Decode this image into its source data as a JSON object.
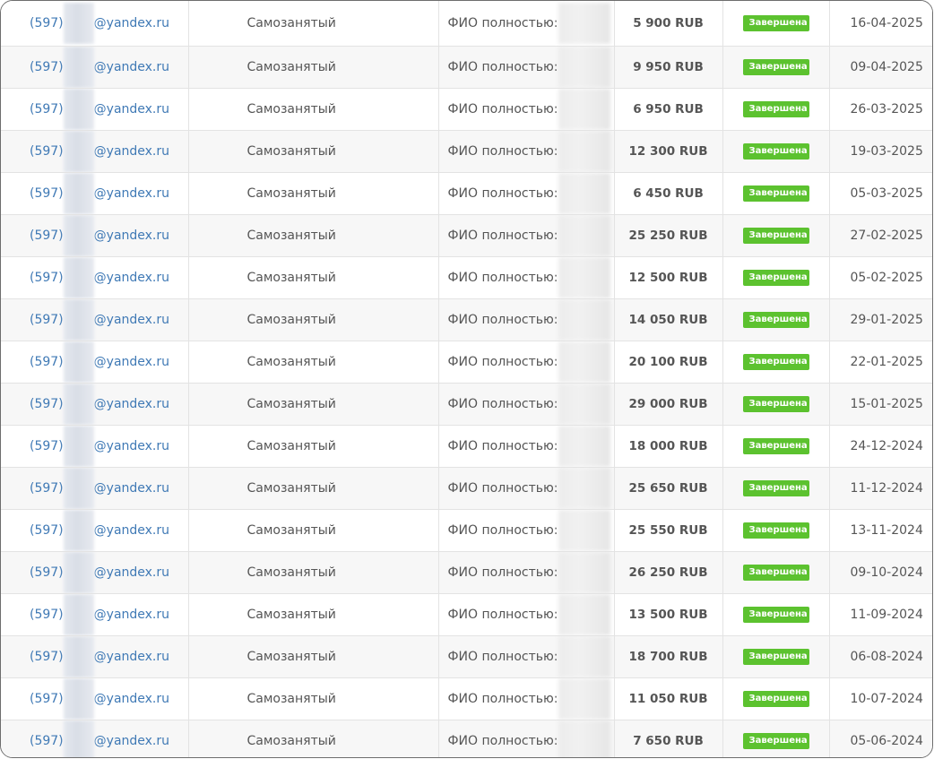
{
  "status_color": "#5cc22f",
  "link_color": "#3f79b5",
  "rows": [
    {
      "email_prefix": "(597)",
      "email_domain": "@yandex.ru",
      "type": "Самозанятый",
      "fio_label": "ФИО полностью:",
      "amount": "5 900 RUB",
      "status": "Завершена",
      "date": "16-04-2025"
    },
    {
      "email_prefix": "(597)",
      "email_domain": "@yandex.ru",
      "type": "Самозанятый",
      "fio_label": "ФИО полностью:",
      "amount": "9 950 RUB",
      "status": "Завершена",
      "date": "09-04-2025"
    },
    {
      "email_prefix": "(597)",
      "email_domain": "@yandex.ru",
      "type": "Самозанятый",
      "fio_label": "ФИО полностью:",
      "amount": "6 950 RUB",
      "status": "Завершена",
      "date": "26-03-2025"
    },
    {
      "email_prefix": "(597)",
      "email_domain": "@yandex.ru",
      "type": "Самозанятый",
      "fio_label": "ФИО полностью:",
      "amount": "12 300 RUB",
      "status": "Завершена",
      "date": "19-03-2025"
    },
    {
      "email_prefix": "(597)",
      "email_domain": "@yandex.ru",
      "type": "Самозанятый",
      "fio_label": "ФИО полностью:",
      "amount": "6 450 RUB",
      "status": "Завершена",
      "date": "05-03-2025"
    },
    {
      "email_prefix": "(597)",
      "email_domain": "@yandex.ru",
      "type": "Самозанятый",
      "fio_label": "ФИО полностью:",
      "amount": "25 250 RUB",
      "status": "Завершена",
      "date": "27-02-2025"
    },
    {
      "email_prefix": "(597)",
      "email_domain": "@yandex.ru",
      "type": "Самозанятый",
      "fio_label": "ФИО полностью:",
      "amount": "12 500 RUB",
      "status": "Завершена",
      "date": "05-02-2025"
    },
    {
      "email_prefix": "(597)",
      "email_domain": "@yandex.ru",
      "type": "Самозанятый",
      "fio_label": "ФИО полностью:",
      "amount": "14 050 RUB",
      "status": "Завершена",
      "date": "29-01-2025"
    },
    {
      "email_prefix": "(597)",
      "email_domain": "@yandex.ru",
      "type": "Самозанятый",
      "fio_label": "ФИО полностью:",
      "amount": "20 100 RUB",
      "status": "Завершена",
      "date": "22-01-2025"
    },
    {
      "email_prefix": "(597)",
      "email_domain": "@yandex.ru",
      "type": "Самозанятый",
      "fio_label": "ФИО полностью:",
      "amount": "29 000 RUB",
      "status": "Завершена",
      "date": "15-01-2025"
    },
    {
      "email_prefix": "(597)",
      "email_domain": "@yandex.ru",
      "type": "Самозанятый",
      "fio_label": "ФИО полностью:",
      "amount": "18 000 RUB",
      "status": "Завершена",
      "date": "24-12-2024"
    },
    {
      "email_prefix": "(597)",
      "email_domain": "@yandex.ru",
      "type": "Самозанятый",
      "fio_label": "ФИО полностью:",
      "amount": "25 650 RUB",
      "status": "Завершена",
      "date": "11-12-2024"
    },
    {
      "email_prefix": "(597)",
      "email_domain": "@yandex.ru",
      "type": "Самозанятый",
      "fio_label": "ФИО полностью:",
      "amount": "25 550 RUB",
      "status": "Завершена",
      "date": "13-11-2024"
    },
    {
      "email_prefix": "(597)",
      "email_domain": "@yandex.ru",
      "type": "Самозанятый",
      "fio_label": "ФИО полностью:",
      "amount": "26 250 RUB",
      "status": "Завершена",
      "date": "09-10-2024"
    },
    {
      "email_prefix": "(597)",
      "email_domain": "@yandex.ru",
      "type": "Самозанятый",
      "fio_label": "ФИО полностью:",
      "amount": "13 500 RUB",
      "status": "Завершена",
      "date": "11-09-2024"
    },
    {
      "email_prefix": "(597)",
      "email_domain": "@yandex.ru",
      "type": "Самозанятый",
      "fio_label": "ФИО полностью:",
      "amount": "18 700 RUB",
      "status": "Завершена",
      "date": "06-08-2024"
    },
    {
      "email_prefix": "(597)",
      "email_domain": "@yandex.ru",
      "type": "Самозанятый",
      "fio_label": "ФИО полностью:",
      "amount": "11 050 RUB",
      "status": "Завершена",
      "date": "10-07-2024"
    },
    {
      "email_prefix": "(597)",
      "email_domain": "@yandex.ru",
      "type": "Самозанятый",
      "fio_label": "ФИО полностью:",
      "amount": "7 650 RUB",
      "status": "Завершена",
      "date": "05-06-2024"
    }
  ]
}
